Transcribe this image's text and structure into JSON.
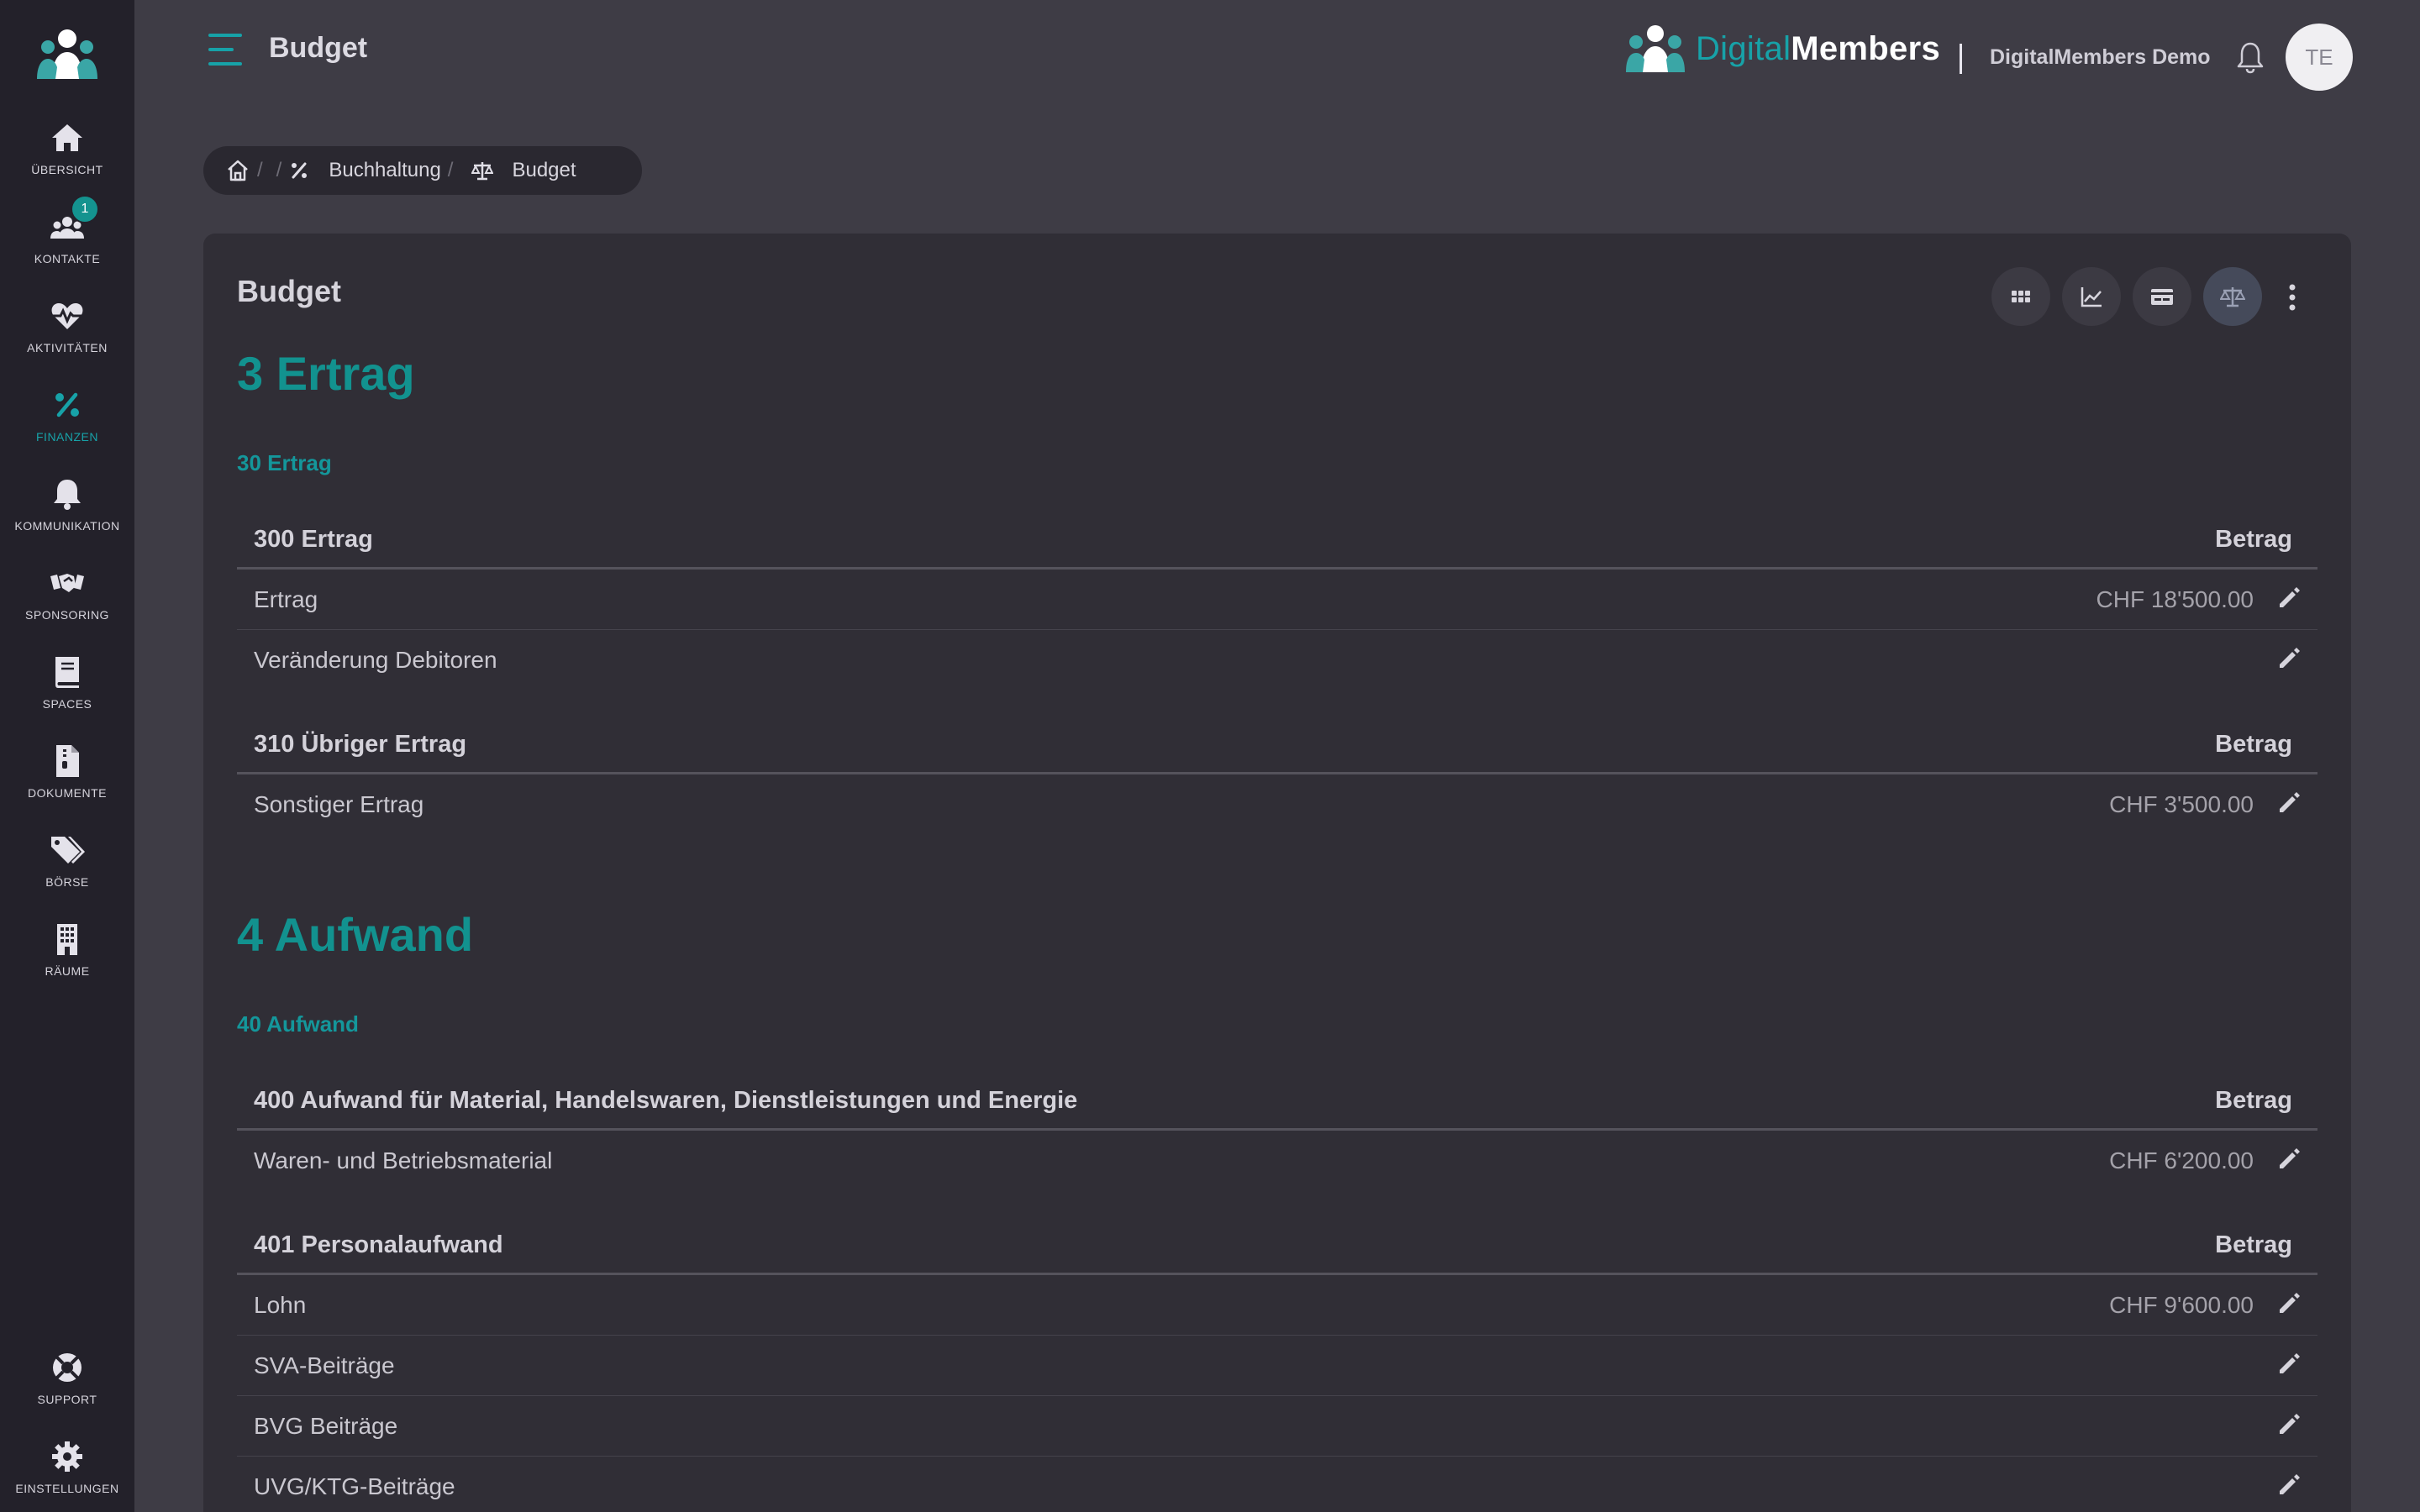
{
  "sidebar": {
    "items": [
      {
        "label": "ÜBERSICHT",
        "icon": "home-icon"
      },
      {
        "label": "KONTAKTE",
        "icon": "users-icon",
        "badge": "1"
      },
      {
        "label": "AKTIVITÄTEN",
        "icon": "heart-pulse-icon"
      },
      {
        "label": "FINANZEN",
        "icon": "percent-icon",
        "active": true
      },
      {
        "label": "KOMMUNIKATION",
        "icon": "bell-icon"
      },
      {
        "label": "SPONSORING",
        "icon": "handshake-icon"
      },
      {
        "label": "SPACES",
        "icon": "book-icon"
      },
      {
        "label": "DOKUMENTE",
        "icon": "file-zip-icon"
      },
      {
        "label": "BÖRSE",
        "icon": "tags-icon"
      },
      {
        "label": "RÄUME",
        "icon": "building-icon"
      }
    ],
    "bottom": [
      {
        "label": "SUPPORT",
        "icon": "lifebuoy-icon"
      },
      {
        "label": "EINSTELLUNGEN",
        "icon": "gear-icon"
      }
    ]
  },
  "header": {
    "title": "Budget",
    "brand_light": "Digital",
    "brand_bold": "Members",
    "org_name": "DigitalMembers Demo",
    "avatar_initials": "TE"
  },
  "breadcrumb": {
    "items": [
      "Buchhaltung",
      "Budget"
    ]
  },
  "card": {
    "title": "Budget",
    "toolbar": [
      "grid-icon",
      "chart-line-icon",
      "card-icon",
      "balance-scale-icon"
    ]
  },
  "budget": {
    "ertrag": {
      "title": "3 Ertrag",
      "subtitle": "30 Ertrag",
      "tables": [
        {
          "name": "300 Ertrag",
          "amount_header": "Betrag",
          "rows": [
            {
              "name": "Ertrag",
              "amount": "CHF 18'500.00"
            },
            {
              "name": "Veränderung Debitoren",
              "amount": ""
            }
          ]
        },
        {
          "name": "310 Übriger Ertrag",
          "amount_header": "Betrag",
          "rows": [
            {
              "name": "Sonstiger Ertrag",
              "amount": "CHF 3'500.00"
            }
          ]
        }
      ]
    },
    "aufwand": {
      "title": "4 Aufwand",
      "subtitle": "40 Aufwand",
      "tables": [
        {
          "name": "400 Aufwand für Material, Handelswaren, Dienstleistungen und Energie",
          "amount_header": "Betrag",
          "rows": [
            {
              "name": "Waren- und Betriebsmaterial",
              "amount": "CHF 6'200.00"
            }
          ]
        },
        {
          "name": "401 Personalaufwand",
          "amount_header": "Betrag",
          "rows": [
            {
              "name": "Lohn",
              "amount": "CHF 9'600.00"
            },
            {
              "name": "SVA-Beiträge",
              "amount": ""
            },
            {
              "name": "BVG Beiträge",
              "amount": ""
            },
            {
              "name": "UVG/KTG-Beiträge",
              "amount": ""
            }
          ]
        }
      ]
    }
  },
  "colors": {
    "accent": "#14979b",
    "sidebar_bg": "#23212a",
    "page_bg": "#3e3c45",
    "card_bg": "#302e36"
  }
}
